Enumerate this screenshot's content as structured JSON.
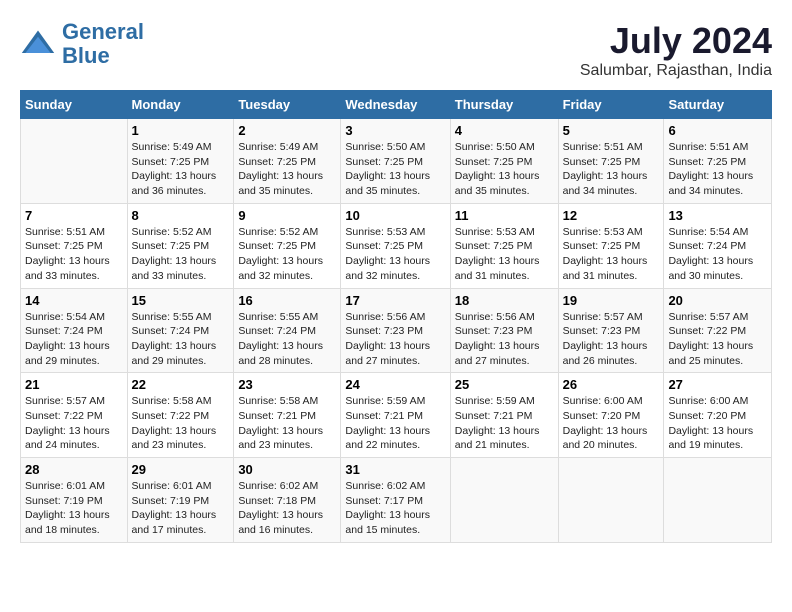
{
  "logo": {
    "line1": "General",
    "line2": "Blue"
  },
  "title": "July 2024",
  "subtitle": "Salumbar, Rajasthan, India",
  "days_header": [
    "Sunday",
    "Monday",
    "Tuesday",
    "Wednesday",
    "Thursday",
    "Friday",
    "Saturday"
  ],
  "weeks": [
    [
      {
        "num": "",
        "info": ""
      },
      {
        "num": "1",
        "info": "Sunrise: 5:49 AM\nSunset: 7:25 PM\nDaylight: 13 hours\nand 36 minutes."
      },
      {
        "num": "2",
        "info": "Sunrise: 5:49 AM\nSunset: 7:25 PM\nDaylight: 13 hours\nand 35 minutes."
      },
      {
        "num": "3",
        "info": "Sunrise: 5:50 AM\nSunset: 7:25 PM\nDaylight: 13 hours\nand 35 minutes."
      },
      {
        "num": "4",
        "info": "Sunrise: 5:50 AM\nSunset: 7:25 PM\nDaylight: 13 hours\nand 35 minutes."
      },
      {
        "num": "5",
        "info": "Sunrise: 5:51 AM\nSunset: 7:25 PM\nDaylight: 13 hours\nand 34 minutes."
      },
      {
        "num": "6",
        "info": "Sunrise: 5:51 AM\nSunset: 7:25 PM\nDaylight: 13 hours\nand 34 minutes."
      }
    ],
    [
      {
        "num": "7",
        "info": "Sunrise: 5:51 AM\nSunset: 7:25 PM\nDaylight: 13 hours\nand 33 minutes."
      },
      {
        "num": "8",
        "info": "Sunrise: 5:52 AM\nSunset: 7:25 PM\nDaylight: 13 hours\nand 33 minutes."
      },
      {
        "num": "9",
        "info": "Sunrise: 5:52 AM\nSunset: 7:25 PM\nDaylight: 13 hours\nand 32 minutes."
      },
      {
        "num": "10",
        "info": "Sunrise: 5:53 AM\nSunset: 7:25 PM\nDaylight: 13 hours\nand 32 minutes."
      },
      {
        "num": "11",
        "info": "Sunrise: 5:53 AM\nSunset: 7:25 PM\nDaylight: 13 hours\nand 31 minutes."
      },
      {
        "num": "12",
        "info": "Sunrise: 5:53 AM\nSunset: 7:25 PM\nDaylight: 13 hours\nand 31 minutes."
      },
      {
        "num": "13",
        "info": "Sunrise: 5:54 AM\nSunset: 7:24 PM\nDaylight: 13 hours\nand 30 minutes."
      }
    ],
    [
      {
        "num": "14",
        "info": "Sunrise: 5:54 AM\nSunset: 7:24 PM\nDaylight: 13 hours\nand 29 minutes."
      },
      {
        "num": "15",
        "info": "Sunrise: 5:55 AM\nSunset: 7:24 PM\nDaylight: 13 hours\nand 29 minutes."
      },
      {
        "num": "16",
        "info": "Sunrise: 5:55 AM\nSunset: 7:24 PM\nDaylight: 13 hours\nand 28 minutes."
      },
      {
        "num": "17",
        "info": "Sunrise: 5:56 AM\nSunset: 7:23 PM\nDaylight: 13 hours\nand 27 minutes."
      },
      {
        "num": "18",
        "info": "Sunrise: 5:56 AM\nSunset: 7:23 PM\nDaylight: 13 hours\nand 27 minutes."
      },
      {
        "num": "19",
        "info": "Sunrise: 5:57 AM\nSunset: 7:23 PM\nDaylight: 13 hours\nand 26 minutes."
      },
      {
        "num": "20",
        "info": "Sunrise: 5:57 AM\nSunset: 7:22 PM\nDaylight: 13 hours\nand 25 minutes."
      }
    ],
    [
      {
        "num": "21",
        "info": "Sunrise: 5:57 AM\nSunset: 7:22 PM\nDaylight: 13 hours\nand 24 minutes."
      },
      {
        "num": "22",
        "info": "Sunrise: 5:58 AM\nSunset: 7:22 PM\nDaylight: 13 hours\nand 23 minutes."
      },
      {
        "num": "23",
        "info": "Sunrise: 5:58 AM\nSunset: 7:21 PM\nDaylight: 13 hours\nand 23 minutes."
      },
      {
        "num": "24",
        "info": "Sunrise: 5:59 AM\nSunset: 7:21 PM\nDaylight: 13 hours\nand 22 minutes."
      },
      {
        "num": "25",
        "info": "Sunrise: 5:59 AM\nSunset: 7:21 PM\nDaylight: 13 hours\nand 21 minutes."
      },
      {
        "num": "26",
        "info": "Sunrise: 6:00 AM\nSunset: 7:20 PM\nDaylight: 13 hours\nand 20 minutes."
      },
      {
        "num": "27",
        "info": "Sunrise: 6:00 AM\nSunset: 7:20 PM\nDaylight: 13 hours\nand 19 minutes."
      }
    ],
    [
      {
        "num": "28",
        "info": "Sunrise: 6:01 AM\nSunset: 7:19 PM\nDaylight: 13 hours\nand 18 minutes."
      },
      {
        "num": "29",
        "info": "Sunrise: 6:01 AM\nSunset: 7:19 PM\nDaylight: 13 hours\nand 17 minutes."
      },
      {
        "num": "30",
        "info": "Sunrise: 6:02 AM\nSunset: 7:18 PM\nDaylight: 13 hours\nand 16 minutes."
      },
      {
        "num": "31",
        "info": "Sunrise: 6:02 AM\nSunset: 7:17 PM\nDaylight: 13 hours\nand 15 minutes."
      },
      {
        "num": "",
        "info": ""
      },
      {
        "num": "",
        "info": ""
      },
      {
        "num": "",
        "info": ""
      }
    ]
  ]
}
